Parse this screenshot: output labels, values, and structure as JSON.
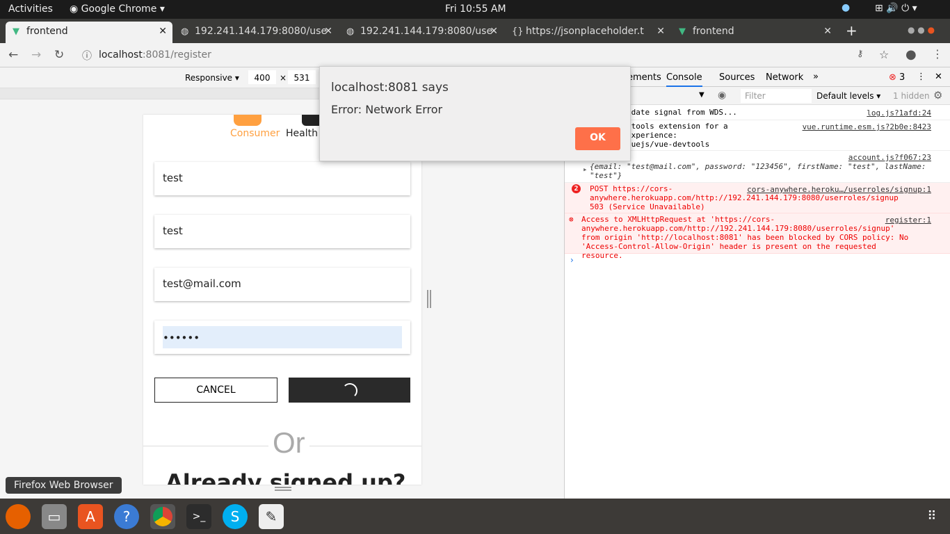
{
  "topbar": {
    "activities": "Activities",
    "app": "Google Chrome",
    "clock": "Fri 10:55 AM"
  },
  "tabs": [
    {
      "label": "frontend"
    },
    {
      "label": "192.241.144.179:8080/use"
    },
    {
      "label": "192.241.144.179:8080/use"
    },
    {
      "label": "https://jsonplaceholder.t"
    },
    {
      "label": "frontend"
    }
  ],
  "address": {
    "host": "localhost",
    "rest": ":8081/register"
  },
  "device": {
    "mode": "Responsive",
    "width": "400",
    "height": "531"
  },
  "page": {
    "role_consumer": "Consumer",
    "role_health": "Health C",
    "fields": [
      "test",
      "test",
      "test@mail.com",
      "••••••"
    ],
    "cancel": "CANCEL",
    "or": "Or",
    "signed": "Already signed up?"
  },
  "dialog": {
    "title": "localhost:8081 says",
    "message": "Error: Network Error",
    "ok": "OK"
  },
  "devtools": {
    "tabs": [
      "ements",
      "Console",
      "Sources",
      "Network",
      "»"
    ],
    "errors": "3",
    "filter_placeholder": "Filter",
    "levels": "Default levels ▾",
    "hidden": "1 hidden",
    "logs": [
      {
        "text": "ng for update signal from WDS...",
        "src": "log.js?1afd:24"
      },
      {
        "text": "e Vue Devtools extension for a\nlopment experience:\nhub.com/vuejs/vue-devtools",
        "src": "vue.runtime.esm.js?2b0e:8423"
      },
      {
        "text": "{email: \"test@mail.com\", password: \"123456\", firstName: \"test\", lastName: \"test\"}",
        "src": "account.js?f067:23"
      },
      {
        "count": "2",
        "text": "POST https://cors-anywhere.herokuapp.com/http://192.241.144.179:8080/userroles/signup 503 (Service Unavailable)",
        "src": "cors-anywhere.heroku…/userroles/signup:1"
      },
      {
        "text": "Access to XMLHttpRequest at 'https://cors-anywhere.herokuapp.com/http://192.241.144.179:8080/userroles/signup' from origin 'http://localhost:8081' has been blocked by CORS policy: No 'Access-Control-Allow-Origin' header is present on the requested resource.",
        "src": "register:1"
      }
    ]
  },
  "tooltip": "Firefox Web Browser"
}
